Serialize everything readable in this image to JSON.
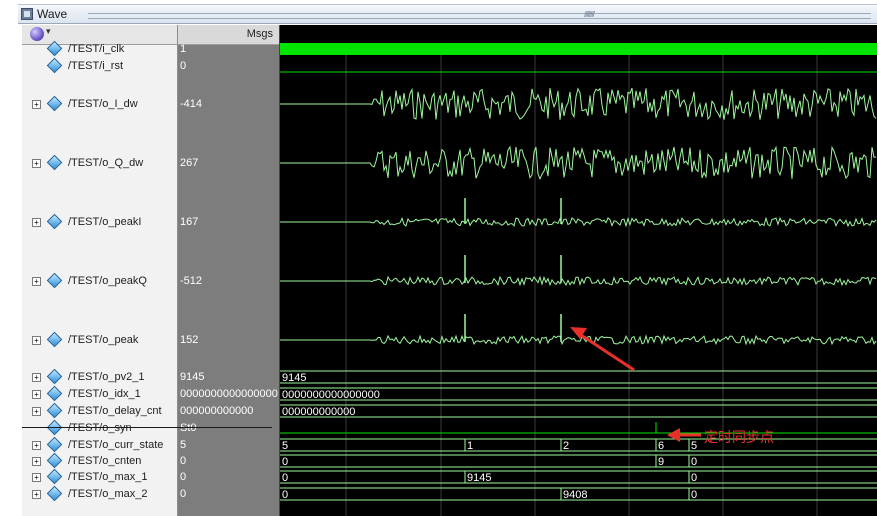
{
  "window": {
    "title": "Wave"
  },
  "columns": {
    "msgs_label": "Msgs"
  },
  "annotation": {
    "text": "定时同步点",
    "color": "#e8302a"
  },
  "colors": {
    "wave": "#9ef79e",
    "clock": "#00e400",
    "grid": "#3a3a3a",
    "bus_text": "#ffffff"
  },
  "signals": [
    {
      "name": "/TEST/i_clk",
      "value": "1",
      "expand": false,
      "kind": "clock"
    },
    {
      "name": "/TEST/i_rst",
      "value": "0",
      "expand": false,
      "kind": "flat"
    },
    {
      "name": "/TEST/o_I_dw",
      "value": "-414",
      "expand": true,
      "kind": "analog"
    },
    {
      "name": "/TEST/o_Q_dw",
      "value": "267",
      "expand": true,
      "kind": "analog"
    },
    {
      "name": "/TEST/o_peakI",
      "value": "167",
      "expand": true,
      "kind": "analog-peak"
    },
    {
      "name": "/TEST/o_peakQ",
      "value": "-512",
      "expand": true,
      "kind": "analog-peak"
    },
    {
      "name": "/TEST/o_peak",
      "value": "152",
      "expand": true,
      "kind": "analog-peak"
    },
    {
      "name": "/TEST/o_pv2_1",
      "value": "9145",
      "expand": true,
      "kind": "bus",
      "segments": [
        "9145"
      ]
    },
    {
      "name": "/TEST/o_idx_1",
      "value": "0000000000000000",
      "expand": true,
      "kind": "bus",
      "segments": [
        "0000000000000000"
      ]
    },
    {
      "name": "/TEST/o_delay_cnt",
      "value": "000000000000",
      "expand": true,
      "kind": "bus",
      "segments": [
        "000000000000"
      ]
    },
    {
      "name": "/TEST/o_syn",
      "value": "St0",
      "expand": false,
      "kind": "syn"
    },
    {
      "name": "/TEST/o_curr_state",
      "value": "5",
      "expand": true,
      "kind": "bus",
      "segments": [
        "5",
        "1",
        "2",
        "6",
        "5"
      ]
    },
    {
      "name": "/TEST/o_cnten",
      "value": "0",
      "expand": true,
      "kind": "bus",
      "segments": [
        "0",
        "9",
        "0"
      ]
    },
    {
      "name": "/TEST/o_max_1",
      "value": "0",
      "expand": true,
      "kind": "bus",
      "segments": [
        "0",
        "9145",
        "0"
      ]
    },
    {
      "name": "/TEST/o_max_2",
      "value": "0",
      "expand": true,
      "kind": "bus",
      "segments": [
        "0",
        "9408",
        "0"
      ]
    }
  ]
}
